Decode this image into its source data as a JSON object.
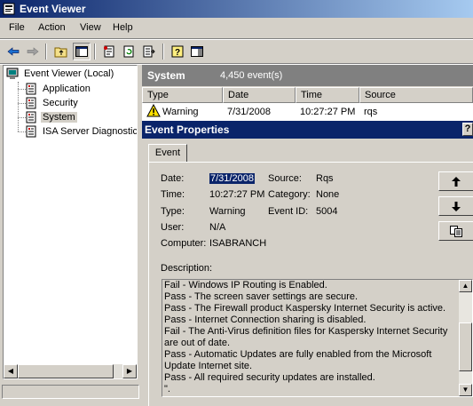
{
  "window": {
    "title": "Event Viewer"
  },
  "menu": [
    "File",
    "Action",
    "View",
    "Help"
  ],
  "toolbar": {
    "buttons": [
      "back-icon",
      "forward-icon",
      "up-folder-icon",
      "show-hide-tree-icon",
      "properties-icon",
      "refresh-icon",
      "export-list-icon",
      "help-icon",
      "console-icon"
    ]
  },
  "tree": {
    "root": "Event Viewer (Local)",
    "items": [
      "Application",
      "Security",
      "System",
      "ISA Server Diagnostics"
    ],
    "selected": "System"
  },
  "pane": {
    "name": "System",
    "count": "4,450 event(s)"
  },
  "list": {
    "columns": [
      "Type",
      "Date",
      "Time",
      "Source"
    ],
    "rows": [
      {
        "type": "Warning",
        "date": "7/31/2008",
        "time": "10:27:27 PM",
        "source": "rqs"
      }
    ]
  },
  "dialog": {
    "title": "Event Properties",
    "help": "?",
    "tab": "Event",
    "labels": {
      "date": "Date:",
      "time": "Time:",
      "type": "Type:",
      "user": "User:",
      "computer": "Computer:",
      "source": "Source:",
      "category": "Category:",
      "event_id": "Event ID:",
      "description": "Description:"
    },
    "values": {
      "date": "7/31/2008",
      "time": "10:27:27 PM",
      "type": "Warning",
      "user": "N/A",
      "computer": "ISABRANCH",
      "source": "Rqs",
      "category": "None",
      "event_id": "5004"
    },
    "description_lines": [
      "Fail - Windows IP Routing is Enabled.",
      "Pass - The screen saver settings are secure.",
      "Pass - The Firewall product Kaspersky Internet Security is active.",
      "Pass - Internet Connection sharing is disabled.",
      "Fail - The Anti-Virus definition files for Kaspersky Internet Security are out of date.",
      "Pass - Automatic Updates are fully enabled from the Microsoft Update Internet site.",
      "Pass - All required security updates are installed.",
      "\"."
    ]
  }
}
